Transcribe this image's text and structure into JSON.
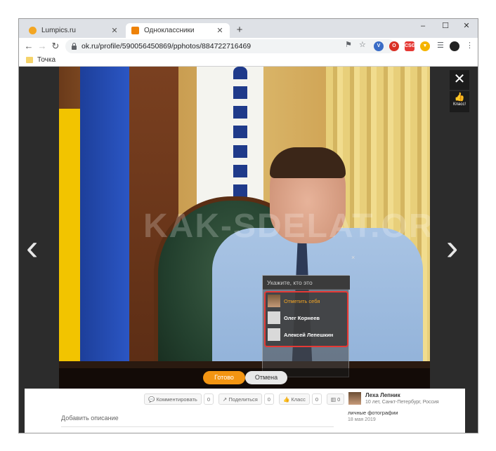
{
  "browser": {
    "tabs": [
      {
        "title": "Lumpics.ru",
        "favicon_color": "#f3a623",
        "active": false
      },
      {
        "title": "Одноклассники",
        "favicon_color": "#ee8208",
        "active": true
      }
    ],
    "new_tab": "+",
    "window_controls": {
      "minimize": "–",
      "maximize": "☐",
      "close": "✕"
    },
    "url": "ok.ru/profile/590056450869/pphotos/884722716469",
    "bookmark": "Точка"
  },
  "viewer": {
    "watermark": "KAK-SDELAT.ORG",
    "close_icon": "✕",
    "klass_label": "Класс!",
    "prev_icon": "‹",
    "next_icon": "›",
    "tag_prompt": "Укажите, кто это",
    "tag_close": "×",
    "tag_people": [
      {
        "name": "Отметить себя",
        "self": true
      },
      {
        "name": "Олег Корнеев",
        "self": false
      },
      {
        "name": "Алексей Лепешкин",
        "self": false
      }
    ],
    "done": "Готово",
    "cancel": "Отмена"
  },
  "info": {
    "comment": "Комментировать",
    "comment_count": "0",
    "share": "Поделиться",
    "share_count": "0",
    "klass": "Класс",
    "klass_count": "0",
    "extra_count": "0",
    "add_description": "Добавить описание",
    "author": "Леха Лепник",
    "author_meta": "10 лет, Санкт-Петербург, Россия",
    "album": "личные фотографии",
    "date": "18 мая 2019"
  }
}
